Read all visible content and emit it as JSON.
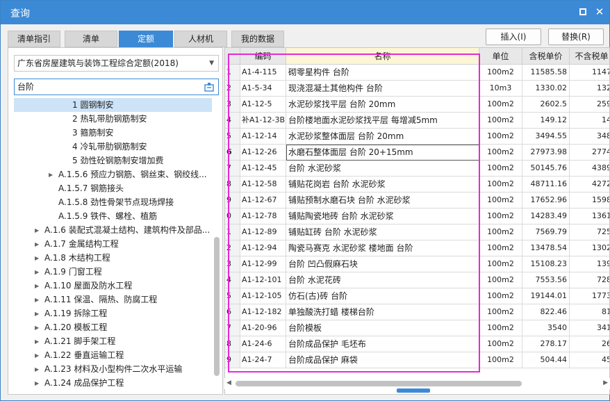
{
  "window": {
    "title": "查询"
  },
  "tabs": [
    {
      "label": "清单指引",
      "active": false
    },
    {
      "label": "清单",
      "active": false
    },
    {
      "label": "定额",
      "active": true
    },
    {
      "label": "人材机",
      "active": false
    },
    {
      "label": "我的数据",
      "active": false
    }
  ],
  "buttons": {
    "insert": "插入(I)",
    "replace": "替换(R)"
  },
  "quota_select": {
    "value": "广东省房屋建筑与装饰工程综合定额(2018)"
  },
  "search": {
    "value": "台阶"
  },
  "tree": [
    {
      "label": "1 圆钢制安",
      "selected": true,
      "expandable": false
    },
    {
      "label": "2 热轧带肋钢筋制安",
      "selected": false,
      "expandable": false
    },
    {
      "label": "3 箍筋制安",
      "selected": false,
      "expandable": false
    },
    {
      "label": "4 冷轧带肋钢筋制安",
      "selected": false,
      "expandable": false
    },
    {
      "label": "5 劲性砼钢筋制安增加费",
      "selected": false,
      "expandable": false
    },
    {
      "label": "A.1.5.6 预应力钢筋、钢丝束、钢绞线...",
      "selected": false,
      "expandable": true
    },
    {
      "label": "A.1.5.7 钢筋接头",
      "selected": false,
      "expandable": false
    },
    {
      "label": "A.1.5.8 劲性骨架节点现场焊接",
      "selected": false,
      "expandable": false
    },
    {
      "label": "A.1.5.9 铁件、螺栓、植筋",
      "selected": false,
      "expandable": false
    },
    {
      "label": "A.1.6 装配式混凝土结构、建筑构件及部品...",
      "selected": false,
      "expandable": true
    },
    {
      "label": "A.1.7 金属结构工程",
      "selected": false,
      "expandable": true
    },
    {
      "label": "A.1.8 木结构工程",
      "selected": false,
      "expandable": true
    },
    {
      "label": "A.1.9 门窗工程",
      "selected": false,
      "expandable": true
    },
    {
      "label": "A.1.10 屋面及防水工程",
      "selected": false,
      "expandable": true
    },
    {
      "label": "A.1.11 保温、隔热、防腐工程",
      "selected": false,
      "expandable": true
    },
    {
      "label": "A.1.19 拆除工程",
      "selected": false,
      "expandable": true
    },
    {
      "label": "A.1.20 模板工程",
      "selected": false,
      "expandable": true
    },
    {
      "label": "A.1.21 脚手架工程",
      "selected": false,
      "expandable": true
    },
    {
      "label": "A.1.22 垂直运输工程",
      "selected": false,
      "expandable": true
    },
    {
      "label": "A.1.23 材料及小型构件二次水平运输",
      "selected": false,
      "expandable": true
    },
    {
      "label": "A.1.24 成品保护工程",
      "selected": false,
      "expandable": true
    }
  ],
  "table": {
    "columns": [
      "编码",
      "名称",
      "单位",
      "含税单价",
      "不含税单"
    ],
    "rows": [
      {
        "idx": "1",
        "code": "A1-4-115",
        "name": "砌零星构件 台阶",
        "unit": "100m2",
        "price": "11585.58",
        "price2": "1147"
      },
      {
        "idx": "2",
        "code": "A1-5-34",
        "name": "现浇混凝土其他构件 台阶",
        "unit": "10m3",
        "price": "1330.02",
        "price2": "132"
      },
      {
        "idx": "3",
        "code": "A1-12-5",
        "name": "水泥砂浆找平层 台阶 20mm",
        "unit": "100m2",
        "price": "2602.5",
        "price2": "259"
      },
      {
        "idx": "4",
        "code": "补A1-12-3B",
        "name": "台阶楼地面水泥砂浆找平层 每增减5mm",
        "unit": "100m2",
        "price": "149.12",
        "price2": "14"
      },
      {
        "idx": "5",
        "code": "A1-12-14",
        "name": "水泥砂浆整体面层 台阶 20mm",
        "unit": "100m2",
        "price": "3494.55",
        "price2": "348"
      },
      {
        "idx": "6",
        "code": "A1-12-26",
        "name": "水磨石整体面层 台阶 20+15mm",
        "unit": "100m2",
        "price": "27973.98",
        "price2": "2774"
      },
      {
        "idx": "7",
        "code": "A1-12-45",
        "name": "台阶 水泥砂浆",
        "unit": "100m2",
        "price": "50145.76",
        "price2": "4389"
      },
      {
        "idx": "8",
        "code": "A1-12-58",
        "name": "铺贴花岗岩 台阶 水泥砂浆",
        "unit": "100m2",
        "price": "48711.16",
        "price2": "4272"
      },
      {
        "idx": "9",
        "code": "A1-12-67",
        "name": "铺贴预制水磨石块 台阶 水泥砂浆",
        "unit": "100m2",
        "price": "17652.96",
        "price2": "1598"
      },
      {
        "idx": "0",
        "code": "A1-12-78",
        "name": "铺贴陶瓷地砖 台阶 水泥砂浆",
        "unit": "100m2",
        "price": "14283.49",
        "price2": "1361"
      },
      {
        "idx": "1",
        "code": "A1-12-89",
        "name": "铺贴缸砖 台阶 水泥砂浆",
        "unit": "100m2",
        "price": "7569.79",
        "price2": "725"
      },
      {
        "idx": "2",
        "code": "A1-12-94",
        "name": "陶瓷马赛克 水泥砂浆 楼地面 台阶",
        "unit": "100m2",
        "price": "13478.54",
        "price2": "1302"
      },
      {
        "idx": "3",
        "code": "A1-12-99",
        "name": "台阶 凹凸假麻石块",
        "unit": "100m2",
        "price": "15108.23",
        "price2": "139"
      },
      {
        "idx": "4",
        "code": "A1-12-101",
        "name": "台阶 水泥花砖",
        "unit": "100m2",
        "price": "7553.56",
        "price2": "728"
      },
      {
        "idx": "5",
        "code": "A1-12-105",
        "name": "仿石(古)砖 台阶",
        "unit": "100m2",
        "price": "19144.01",
        "price2": "1773"
      },
      {
        "idx": "6",
        "code": "A1-12-182",
        "name": "单独酸洗打蜡 楼梯台阶",
        "unit": "100m2",
        "price": "822.46",
        "price2": "81"
      },
      {
        "idx": "7",
        "code": "A1-20-96",
        "name": "台阶模板",
        "unit": "100m2",
        "price": "3540",
        "price2": "341"
      },
      {
        "idx": "8",
        "code": "A1-24-6",
        "name": "台阶成品保护 毛坯布",
        "unit": "100m2",
        "price": "278.17",
        "price2": "26"
      },
      {
        "idx": "9",
        "code": "A1-24-7",
        "name": "台阶成品保护 麻袋",
        "unit": "100m2",
        "price": "504.44",
        "price2": "45"
      }
    ],
    "active_row": 5
  },
  "colors": {
    "accent": "#3c8ad5",
    "highlight": "#e629d6",
    "tree_selected": "#cde3f7"
  }
}
